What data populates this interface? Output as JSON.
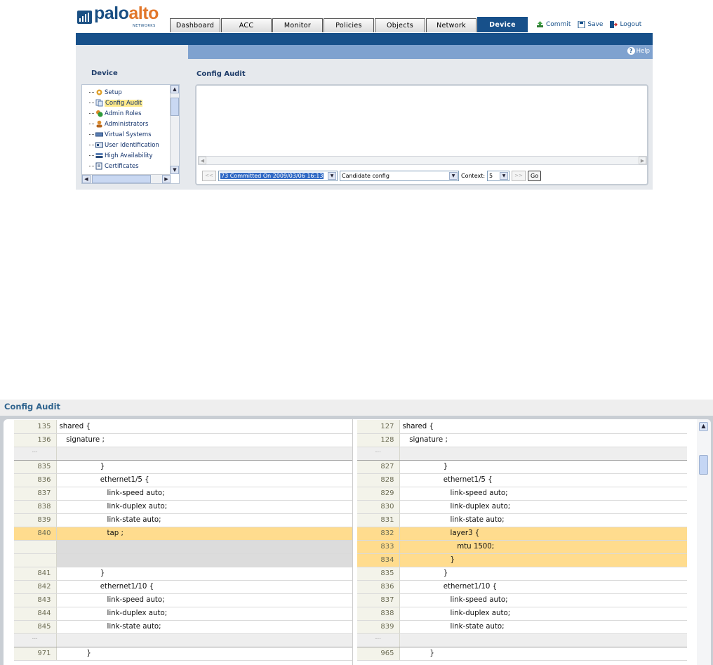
{
  "brand": {
    "logo_main": "palo",
    "logo_accent": "alto",
    "logo_sub": "NETWORKS",
    "color": "#1a4f83",
    "accent": "#e2772b"
  },
  "tabs": [
    {
      "label": "Dashboard",
      "active": false
    },
    {
      "label": "ACC",
      "active": false
    },
    {
      "label": "Monitor",
      "active": false
    },
    {
      "label": "Policies",
      "active": false
    },
    {
      "label": "Objects",
      "active": false
    },
    {
      "label": "Network",
      "active": false
    },
    {
      "label": "Device",
      "active": true
    }
  ],
  "toolbar": {
    "commit": "Commit",
    "save": "Save",
    "logout": "Logout"
  },
  "help": "Help",
  "sidebar": {
    "title": "Device",
    "items": [
      {
        "label": "Setup",
        "icon": "setup-icon"
      },
      {
        "label": "Config Audit",
        "icon": "config-audit-icon",
        "selected": true
      },
      {
        "label": "Admin Roles",
        "icon": "admin-roles-icon"
      },
      {
        "label": "Administrators",
        "icon": "administrators-icon"
      },
      {
        "label": "Virtual Systems",
        "icon": "virtual-systems-icon"
      },
      {
        "label": "User Identification",
        "icon": "user-identification-icon"
      },
      {
        "label": "High Availability",
        "icon": "high-availability-icon"
      },
      {
        "label": "Certificates",
        "icon": "certificates-icon"
      }
    ]
  },
  "main": {
    "title": "Config Audit",
    "prev_btn": "<<",
    "next_btn": ">>",
    "version_select": "73 Committed On 2009/03/06 16:13",
    "compare_select": "Candidate config",
    "context_label": "Context:",
    "context_value": "5",
    "go_btn": "Go"
  },
  "zoom": {
    "title": "Config Audit",
    "gap_marker": "...",
    "left_rows": [
      {
        "n": "135",
        "t": "shared {",
        "type": "normal"
      },
      {
        "n": "136",
        "t": "   signature ;",
        "type": "normal"
      },
      {
        "n": "...",
        "t": "",
        "type": "gap"
      },
      {
        "n": "835",
        "t": "                  }",
        "type": "normal"
      },
      {
        "n": "836",
        "t": "                  ethernet1/5 {",
        "type": "normal"
      },
      {
        "n": "837",
        "t": "                     link-speed auto;",
        "type": "normal"
      },
      {
        "n": "838",
        "t": "                     link-duplex auto;",
        "type": "normal"
      },
      {
        "n": "839",
        "t": "                     link-state auto;",
        "type": "normal"
      },
      {
        "n": "840",
        "t": "                     tap ;",
        "type": "chg"
      },
      {
        "n": "",
        "t": "",
        "type": "blank"
      },
      {
        "n": "",
        "t": "",
        "type": "blank"
      },
      {
        "n": "841",
        "t": "                  }",
        "type": "normal"
      },
      {
        "n": "842",
        "t": "                  ethernet1/10 {",
        "type": "normal"
      },
      {
        "n": "843",
        "t": "                     link-speed auto;",
        "type": "normal"
      },
      {
        "n": "844",
        "t": "                     link-duplex auto;",
        "type": "normal"
      },
      {
        "n": "845",
        "t": "                     link-state auto;",
        "type": "normal"
      },
      {
        "n": "...",
        "t": "",
        "type": "gap"
      },
      {
        "n": "971",
        "t": "            }",
        "type": "normal"
      }
    ],
    "right_rows": [
      {
        "n": "127",
        "t": "shared {",
        "type": "normal"
      },
      {
        "n": "128",
        "t": "   signature ;",
        "type": "normal"
      },
      {
        "n": "...",
        "t": "",
        "type": "gap"
      },
      {
        "n": "827",
        "t": "                  }",
        "type": "normal"
      },
      {
        "n": "828",
        "t": "                  ethernet1/5 {",
        "type": "normal"
      },
      {
        "n": "829",
        "t": "                     link-speed auto;",
        "type": "normal"
      },
      {
        "n": "830",
        "t": "                     link-duplex auto;",
        "type": "normal"
      },
      {
        "n": "831",
        "t": "                     link-state auto;",
        "type": "normal"
      },
      {
        "n": "832",
        "t": "                     layer3 {",
        "type": "chg"
      },
      {
        "n": "833",
        "t": "                        mtu 1500;",
        "type": "chg"
      },
      {
        "n": "834",
        "t": "                     }",
        "type": "chg"
      },
      {
        "n": "835",
        "t": "                  }",
        "type": "normal"
      },
      {
        "n": "836",
        "t": "                  ethernet1/10 {",
        "type": "normal"
      },
      {
        "n": "837",
        "t": "                     link-speed auto;",
        "type": "normal"
      },
      {
        "n": "838",
        "t": "                     link-duplex auto;",
        "type": "normal"
      },
      {
        "n": "839",
        "t": "                     link-state auto;",
        "type": "normal"
      },
      {
        "n": "...",
        "t": "",
        "type": "gap"
      },
      {
        "n": "965",
        "t": "            }",
        "type": "normal"
      }
    ],
    "colors": {
      "changed": "#ffdc8e",
      "blank": "#dcdcdc",
      "gutter": "#f3f3ea"
    }
  }
}
